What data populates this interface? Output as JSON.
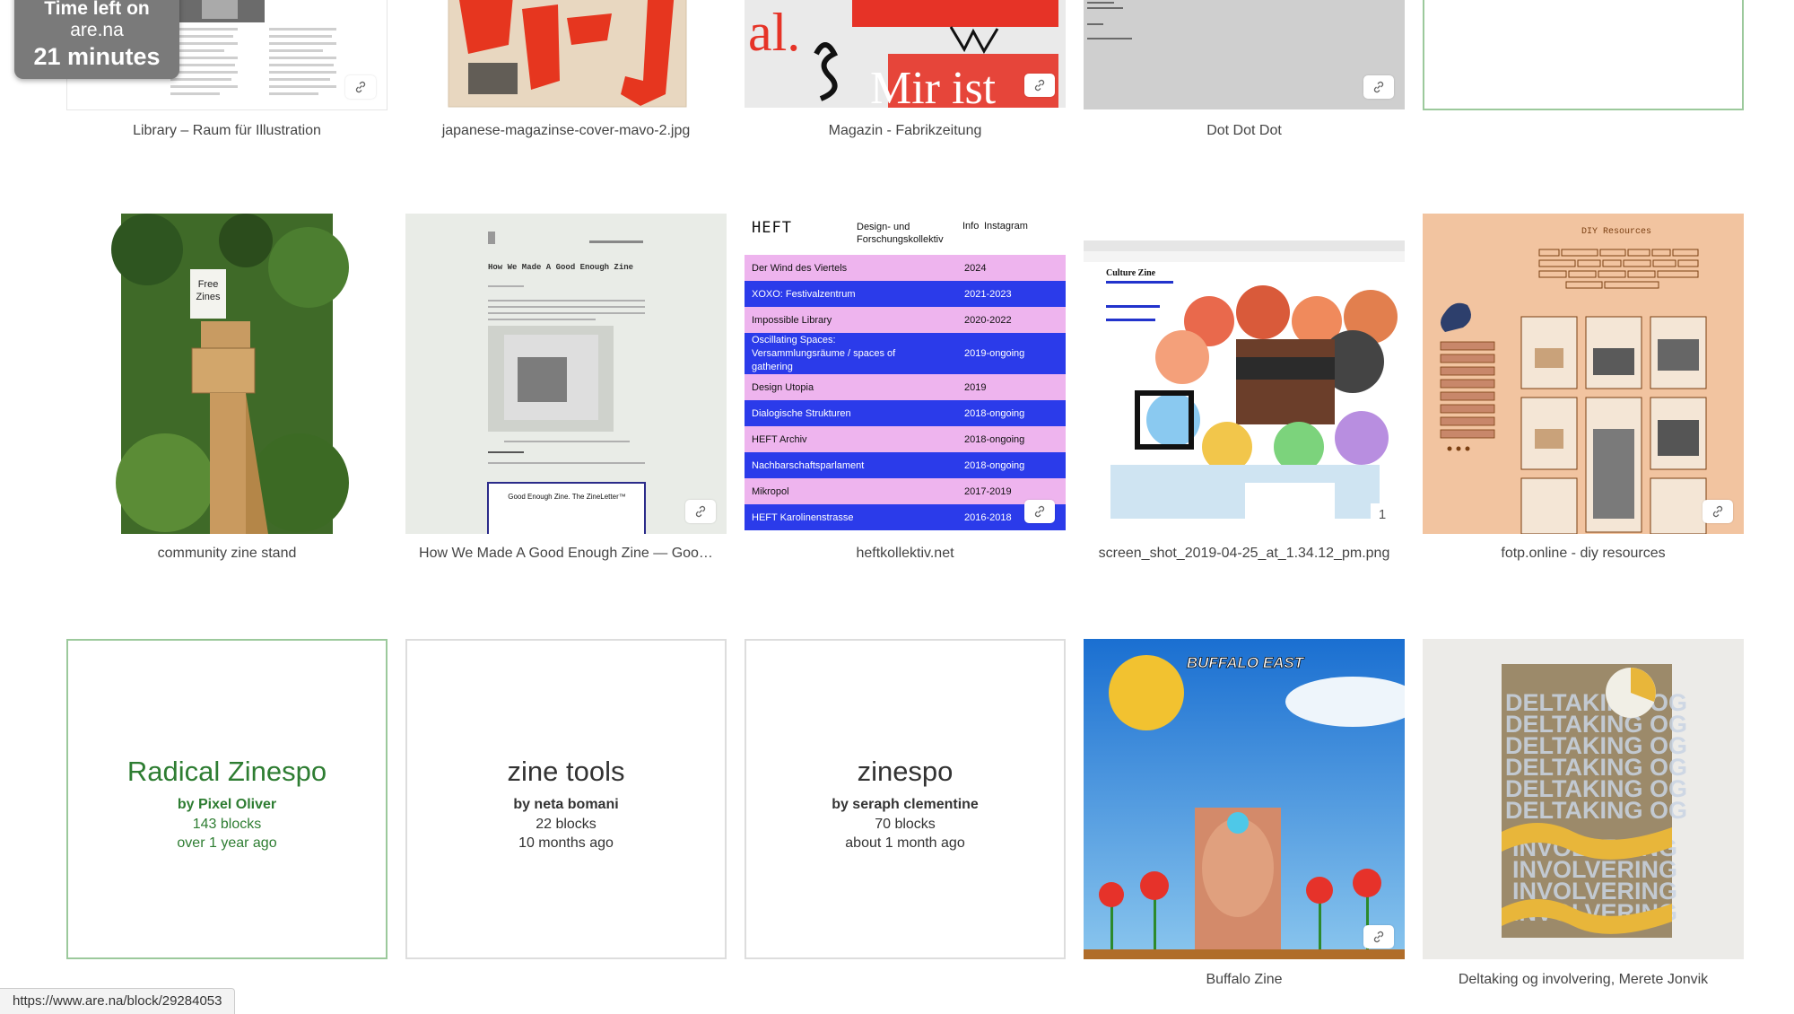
{
  "timer": {
    "line1": "Time left on",
    "line2": "are.na",
    "line3": "21 minutes"
  },
  "row1": [
    {
      "caption": "Library – Raum für Illustration"
    },
    {
      "caption": "japanese-magazinse-cover-mavo-2.jpg"
    },
    {
      "caption": "Magazin - Fabrikzeitung",
      "art_text_1": "al.",
      "art_text_2": "Mir ist"
    },
    {
      "caption": "Dot Dot Dot"
    },
    {
      "caption": ""
    }
  ],
  "row2": [
    {
      "caption": "community zine stand",
      "sign_text": "Free Zines"
    },
    {
      "caption": "How We Made A Good Enough Zine — Goo…",
      "page_heading": "How We Made A Good Enough Zine",
      "newsletter_title": "Good Enough Zine. The ZineLetter™"
    },
    {
      "caption": "heftkollektiv.net",
      "heft": {
        "logo": "HEFT",
        "header_mid": "Design- und Forschungskollektiv",
        "header_info": "Info",
        "header_insta": "Instagram",
        "rows": [
          {
            "name": "Der Wind des Viertels",
            "year": "2024"
          },
          {
            "name": "XOXO: Festivalzentrum",
            "year": "2021-2023"
          },
          {
            "name": "Impossible Library",
            "year": "2020-2022"
          },
          {
            "name": "Oscillating Spaces: Versammlungsräume / spaces of gathering",
            "year": "2019-ongoing"
          },
          {
            "name": "Design Utopia",
            "year": "2019"
          },
          {
            "name": "Dialogische Strukturen",
            "year": "2018-ongoing"
          },
          {
            "name": "HEFT Archiv",
            "year": "2018-ongoing"
          },
          {
            "name": "Nachbarschaftsparlament",
            "year": "2018-ongoing"
          },
          {
            "name": "Mikropol",
            "year": "2017-2019"
          },
          {
            "name": "HEFT Karolinenstrasse",
            "year": "2016-2018"
          }
        ]
      }
    },
    {
      "caption": "screen_shot_2019-04-25_at_1.34.12_pm.png",
      "page_heading": "Culture Zine",
      "count": "1"
    },
    {
      "caption": "fotp.online - diy resources",
      "page_heading": "DIY Resources"
    }
  ],
  "row3": [
    {
      "type": "channel",
      "title": "Radical Zinespo",
      "by": "by Pixel Oliver",
      "blocks": "143 blocks",
      "ago": "over 1 year ago"
    },
    {
      "type": "channel",
      "title": "zine tools",
      "by": "by neta bomani",
      "blocks": "22 blocks",
      "ago": "10 months ago"
    },
    {
      "type": "channel",
      "title": "zinespo",
      "by": "by seraph clementine",
      "blocks": "70 blocks",
      "ago": "about 1 month ago"
    },
    {
      "caption": "Buffalo Zine",
      "cover_title": "BUFFALO EAST"
    },
    {
      "caption": "Deltaking og involvering, Merete Jonvik",
      "cover_line_1": "DELTAKING OG",
      "cover_line_2": "INVOLVERING"
    }
  ],
  "status_bar": {
    "url": "https://www.are.na/block/29284053"
  },
  "colors": {
    "channel_green": "#2e7d32",
    "heft_blue": "#2b3bea",
    "heft_pink": "#eeb4ee",
    "diy_peach": "#f2c4a0"
  }
}
